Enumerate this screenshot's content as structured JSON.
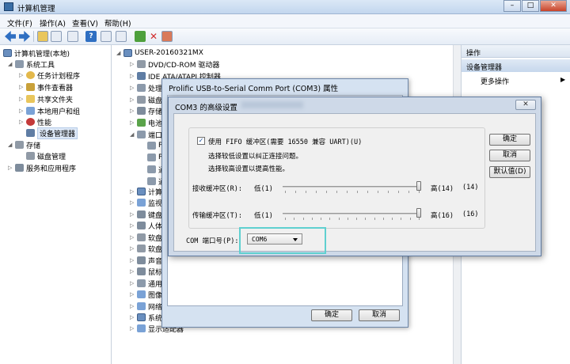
{
  "window": {
    "title": "计算机管理"
  },
  "menu": [
    "文件(F)",
    "操作(A)",
    "查看(V)",
    "帮助(H)"
  ],
  "left_tree": [
    {
      "label": "计算机管理(本地)",
      "icon": "computer-icon"
    },
    {
      "label": "系统工具",
      "icon": "tools-icon"
    },
    {
      "label": "任务计划程序",
      "icon": "clock-icon"
    },
    {
      "label": "事件查看器",
      "icon": "event-icon"
    },
    {
      "label": "共享文件夹",
      "icon": "folder-icon"
    },
    {
      "label": "本地用户和组",
      "icon": "users-icon"
    },
    {
      "label": "性能",
      "icon": "performance-icon"
    },
    {
      "label": "设备管理器",
      "icon": "device-icon"
    },
    {
      "label": "存储",
      "icon": "storage-icon"
    },
    {
      "label": "磁盘管理",
      "icon": "disk-icon"
    },
    {
      "label": "服务和应用程序",
      "icon": "services-icon"
    }
  ],
  "center_tree": [
    "USER-20160321MX",
    "DVD/CD-ROM 驱动器",
    "IDE ATA/ATAPI 控制器",
    "处理",
    "磁盘",
    "存储",
    "电池",
    "端口",
    "P",
    "P",
    "通",
    "通",
    "计算",
    "监视",
    "键盘",
    "人体",
    "软盘",
    "软盘",
    "声音",
    "鼠标",
    "通用",
    "图像",
    "网络",
    "系统",
    "显示适配器"
  ],
  "actions": {
    "header": "操作",
    "section": "设备管理器",
    "more": "更多操作"
  },
  "properties_dialog": {
    "title": "Prolific USB-to-Serial Comm Port (COM3) 属性",
    "ok": "确定",
    "cancel": "取消"
  },
  "advanced_dialog": {
    "title": "COM3 的高级设置",
    "use_fifo": "使用 FIFO 缓冲区(需要 16550 兼容 UART)(U)",
    "hint1": "选择较低设置以纠正连接问题。",
    "hint2": "选择较高设置以提高性能。",
    "rx_label": "接收缓冲区(R):",
    "tx_label": "传输缓冲区(T):",
    "low": "低(1)",
    "rx_high": "高(14)",
    "rx_value": "(14)",
    "tx_high": "高(16)",
    "tx_value": "(16)",
    "rx_level": 1.0,
    "tx_level": 1.0,
    "com_label": "COM 端口号(P):",
    "com_value": "COM6",
    "ok": "确定",
    "cancel": "取消",
    "defaults": "默认值(D)"
  }
}
